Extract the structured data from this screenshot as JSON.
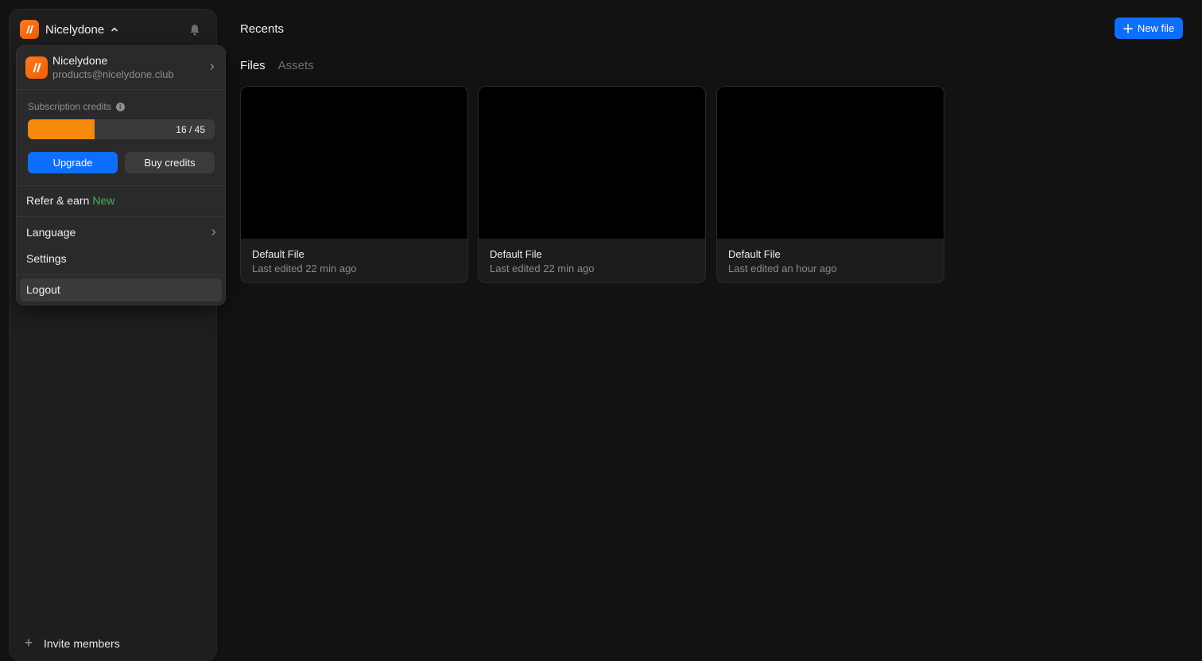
{
  "workspace": {
    "name": "Nicelydone"
  },
  "account": {
    "name": "Nicelydone",
    "email": "products@nicelydone.club"
  },
  "credits": {
    "label": "Subscription credits",
    "used": 16,
    "total": 45,
    "display": "16 / 45",
    "fill_color": "#f7890c"
  },
  "menu": {
    "upgrade_label": "Upgrade",
    "buy_credits_label": "Buy credits",
    "refer_label": "Refer & earn",
    "refer_badge": "New",
    "language_label": "Language",
    "settings_label": "Settings",
    "logout_label": "Logout"
  },
  "sidebar": {
    "invite_label": "Invite members"
  },
  "main": {
    "title": "Recents",
    "new_file_label": "New file",
    "tabs": [
      {
        "label": "Files",
        "active": true
      },
      {
        "label": "Assets",
        "active": false
      }
    ],
    "files": [
      {
        "title": "Default File",
        "edited": "Last edited 22 min ago"
      },
      {
        "title": "Default File",
        "edited": "Last edited 22 min ago"
      },
      {
        "title": "Default File",
        "edited": "Last edited an hour ago"
      }
    ]
  },
  "colors": {
    "accent": "#0d6efd",
    "brand": "#f25c05",
    "badge_new": "#3dbb4f"
  }
}
